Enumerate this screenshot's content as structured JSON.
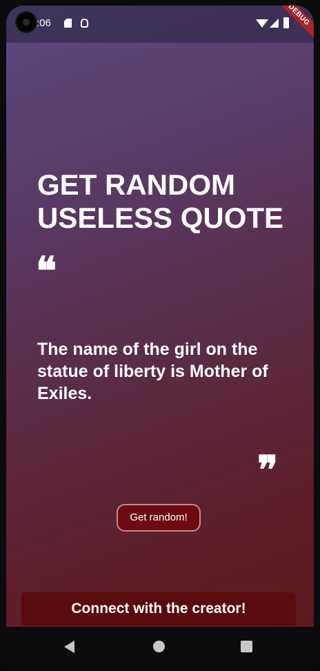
{
  "status_bar": {
    "time": ":06",
    "icons": [
      "camera-cutout",
      "sd-card-icon",
      "android-icon",
      "wifi-icon",
      "signal-icon",
      "battery-icon"
    ]
  },
  "debug_banner": "DEBUG",
  "main": {
    "title": "GET RANDOM USELESS QUOTE",
    "open_quote_mark": "❝",
    "quote_text": "The name of the girl on the statue of liberty is Mother of Exiles.",
    "close_quote_mark": "❞",
    "get_random_label": "Get random!"
  },
  "footer": {
    "connect_label": "Connect with the creator!"
  },
  "nav": {
    "icons": [
      "back-icon",
      "home-icon",
      "recents-icon"
    ]
  },
  "colors": {
    "gradient_top": "#5b4a80",
    "gradient_bottom": "#5f1a1e",
    "button_bg": "#6d0b13",
    "button_border": "#c98690",
    "connect_bg": "#5a0b10",
    "debug_ribbon": "#a3262e"
  }
}
